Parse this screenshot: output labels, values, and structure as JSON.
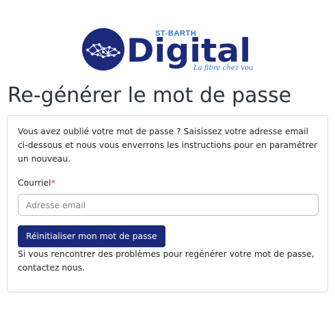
{
  "brand": {
    "logo_small": "ST-BARTH",
    "logo_main": "Digital",
    "logo_tagline": "La fibre chez vous",
    "colors": {
      "navy": "#1b2a7a",
      "accent_blue": "#2b78d6"
    }
  },
  "page": {
    "title": "Re-générer le mot de passe"
  },
  "form": {
    "intro": "Vous avez oublié votre mot de passe ? Saisissez votre adresse email ci-dessous et nous vous enverrons les instructions pour en paramétrer un nouveau.",
    "email_label": "Courriel",
    "required_marker": "*",
    "email_value": "",
    "email_placeholder": "Adresse email",
    "submit_label": "Réinitialiser mon mot de passe",
    "help_text_prefix": "Si vous rencontrer des problèmes pour regénérer votre mot de passe,",
    "help_link": "contactez nous",
    "help_text_suffix": "."
  }
}
